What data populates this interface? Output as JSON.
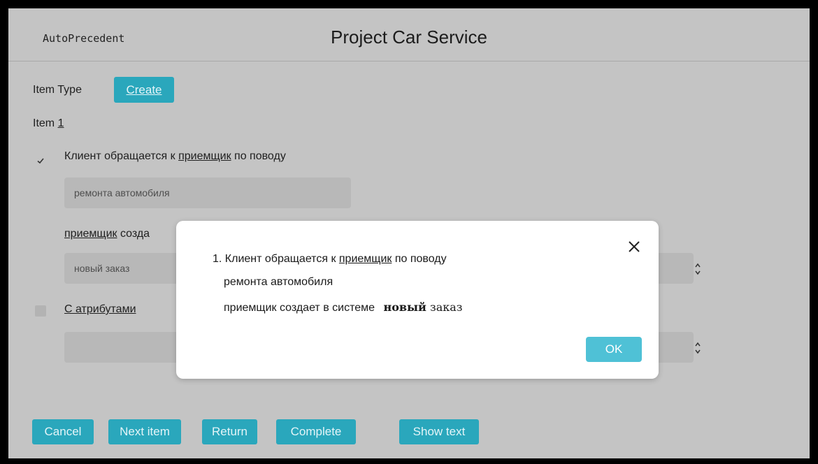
{
  "app": {
    "brand": "AutoPrecedent",
    "title": "Project Car Service"
  },
  "form": {
    "item_type_label": "Item Type",
    "create_button": "Create",
    "item_label": "Item",
    "item_number": "1",
    "step1": {
      "checked": true,
      "text_before": "Клиент обращается к ",
      "link": "приемщик",
      "text_after": " по поводу",
      "field_value": "ремонта автомобиля"
    },
    "step2": {
      "link": "приемщик",
      "text_after": " созда",
      "field_value": "новый заказ"
    },
    "attributes": {
      "checked": false,
      "label": "С атрибутами",
      "field_value": ""
    }
  },
  "footer_buttons": {
    "cancel": "Cancel",
    "next_item": "Next item",
    "return": "Return",
    "complete": "Complete",
    "show_text": "Show text"
  },
  "dialog": {
    "line1_prefix": "1. Клиент обращается к ",
    "line1_link": "приемщик",
    "line1_suffix": " по поводу",
    "line2": "ремонта автомобиля",
    "line3_text": "приемщик создает в системе",
    "line3_bold": "новый",
    "line3_tail": " заказ",
    "ok_button": "OK"
  },
  "colors": {
    "background": "#c4c4c4",
    "accent": "#2aa7bc",
    "ok_button": "#4fc1d6",
    "dialog": "#ffffff"
  },
  "icons": {
    "close": "close-icon",
    "check": "checkmark-icon",
    "stepper": "stepper-icon"
  }
}
